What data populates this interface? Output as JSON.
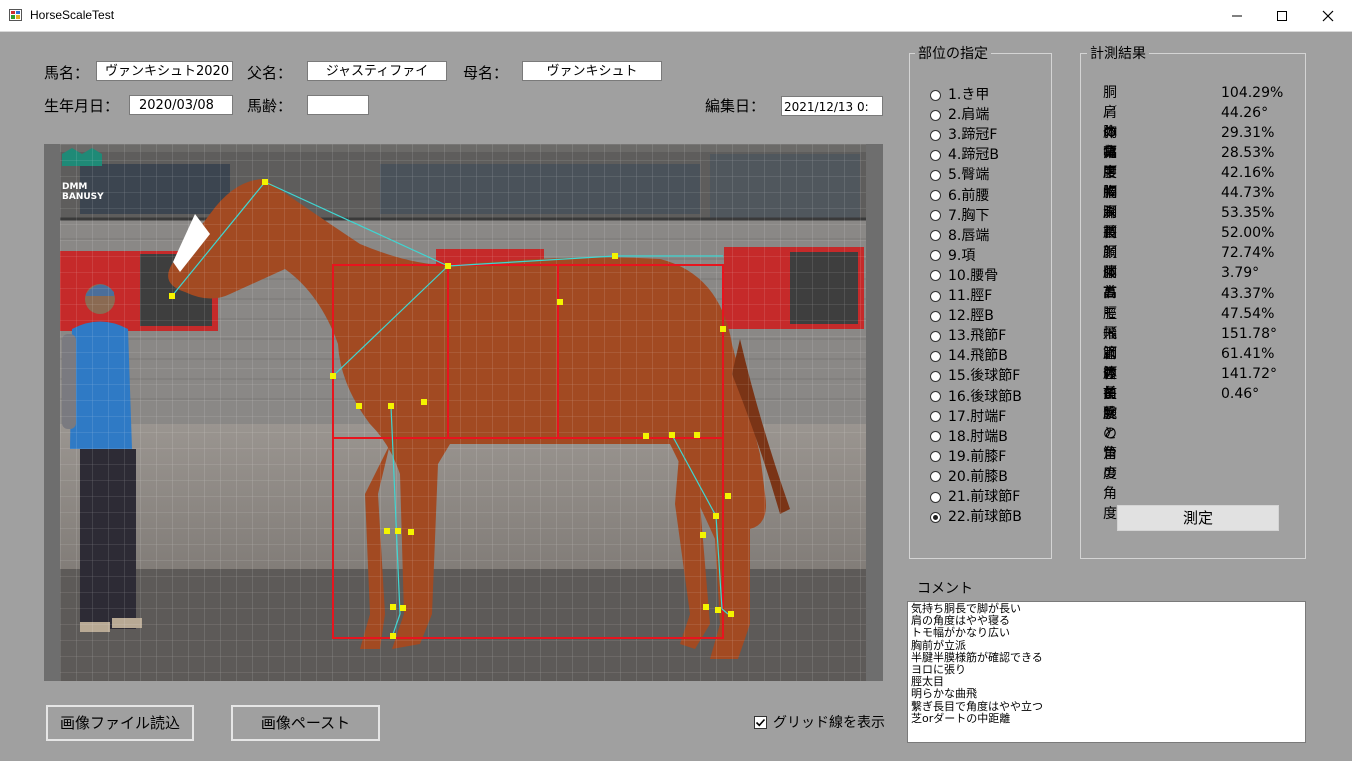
{
  "window": {
    "title": "HorseScaleTest"
  },
  "header": {
    "horse_name_label": "馬名：",
    "horse_name_value": "ヴァンキシュト2020",
    "sire_label": "父名：",
    "sire_value": "ジャスティファイ",
    "dam_label": "母名：",
    "dam_value": "ヴァンキシュト",
    "birthdate_label": "生年月日：",
    "birthdate_value": "2020/03/08",
    "age_label": "馬齢：",
    "age_value": "",
    "edit_date_label": "編集日：",
    "edit_date_value": "2021/12/13 0:"
  },
  "photo": {
    "watermark": "DMM BANUSY"
  },
  "parts": {
    "title": "部位の指定",
    "items": [
      "1.き甲",
      "2.肩端",
      "3.蹄冠F",
      "4.蹄冠B",
      "5.臀端",
      "6.前腰",
      "7.胸下",
      "8.唇端",
      "9.項",
      "10.腰骨",
      "11.脛F",
      "12.脛B",
      "13.飛節F",
      "14.飛節B",
      "15.後球節F",
      "16.後球節B",
      "17.肘端F",
      "18.肘端B",
      "19.前膝F",
      "20.前膝B",
      "21.前球節F",
      "22.前球節B"
    ],
    "selected": "22.前球節B"
  },
  "results": {
    "title": "計測結果",
    "rows": [
      {
        "label": "胴／体高",
        "value": "104.29%"
      },
      {
        "label": "肩の角度",
        "value": "44.26°"
      },
      {
        "label": "胸幅／胴",
        "value": "29.31%"
      },
      {
        "label": "背中／胴",
        "value": "28.53%"
      },
      {
        "label": "腰幅／胴",
        "value": "42.16%"
      },
      {
        "label": "胸深／胴",
        "value": "44.73%"
      },
      {
        "label": "脚長／体高",
        "value": "53.35%"
      },
      {
        "label": "首／胴",
        "value": "52.00%"
      },
      {
        "label": "顔／首",
        "value": "72.74%"
      },
      {
        "label": "腰高",
        "value": "3.79°"
      },
      {
        "label": "トモ／胴体",
        "value": "43.37%"
      },
      {
        "label": "脛幅／脛長",
        "value": "47.54%"
      },
      {
        "label": "飛節の角度",
        "value": "151.78°"
      },
      {
        "label": "管／前腕",
        "value": "61.41%"
      },
      {
        "label": "管と繋の角度",
        "value": "141.72°"
      },
      {
        "label": "前腕と管の角度",
        "value": "0.46°"
      }
    ],
    "measure_button": "測定"
  },
  "comment": {
    "label": "コメント",
    "lines": [
      "気持ち胴長で脚が長い",
      "肩の角度はやや寝る",
      "トモ幅がかなり広い",
      "胸前が立派",
      "半腱半膜様筋が確認できる",
      "ヨロに張り",
      "脛太目",
      "明らかな曲飛",
      "繋ぎ長目で角度はやや立つ",
      "芝orダートの中距離"
    ]
  },
  "footer": {
    "load_image_button": "画像ファイル読込",
    "paste_image_button": "画像ペースト",
    "grid_checkbox_label": "グリッド線を表示",
    "grid_checked": true
  },
  "colors": {
    "form_bg": "#a0a0a0",
    "overlay_red": "#e8141e",
    "overlay_cyan": "#3fd6d2",
    "marker_yellow": "#f4f400",
    "horse_chestnut": "#a24a22"
  }
}
